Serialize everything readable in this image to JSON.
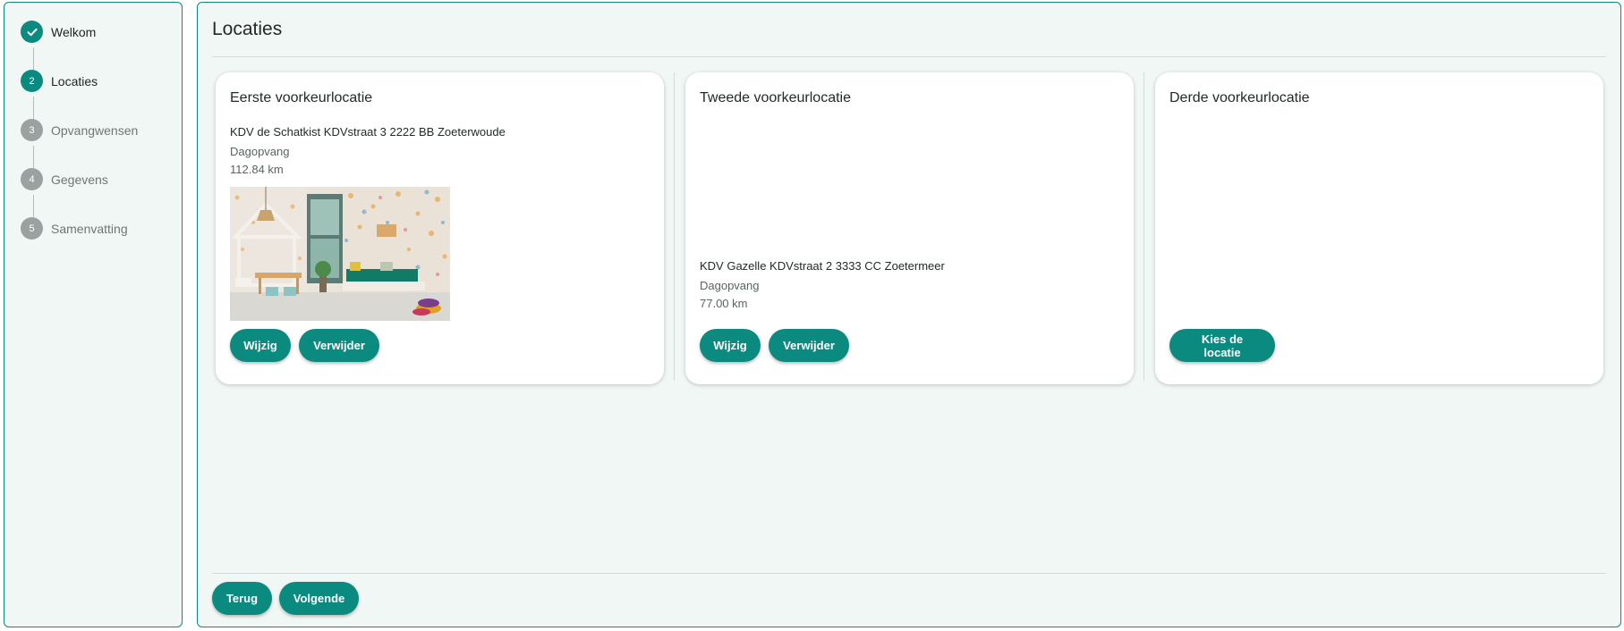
{
  "stepper": {
    "steps": [
      {
        "number": "",
        "label": "Welkom",
        "state": "done",
        "icon": "check-icon"
      },
      {
        "number": "2",
        "label": "Locaties",
        "state": "active"
      },
      {
        "number": "3",
        "label": "Opvangwensen",
        "state": "pending"
      },
      {
        "number": "4",
        "label": "Gegevens",
        "state": "pending"
      },
      {
        "number": "5",
        "label": "Samenvatting",
        "state": "pending"
      }
    ]
  },
  "main": {
    "title": "Locaties",
    "cards": [
      {
        "title": "Eerste voorkeurlocatie",
        "location_name": "KDV de Schatkist KDVstraat 3 2222 BB Zoeterwoude",
        "type": "Dagopvang",
        "distance": "112.84 km",
        "has_photo": true,
        "buttons": {
          "edit": "Wijzig",
          "remove": "Verwijder"
        }
      },
      {
        "title": "Tweede voorkeurlocatie",
        "location_name": "KDV Gazelle KDVstraat 2 3333 CC Zoetermeer",
        "type": "Dagopvang",
        "distance": "77.00 km",
        "has_photo": false,
        "buttons": {
          "edit": "Wijzig",
          "remove": "Verwijder"
        }
      },
      {
        "title": "Derde voorkeurlocatie",
        "buttons": {
          "choose": "Kies de locatie"
        }
      }
    ],
    "footer": {
      "back": "Terug",
      "next": "Volgende"
    }
  },
  "colors": {
    "accent": "#0b8a80",
    "panel_background": "#f1f7f5",
    "pending_step": "#9aa1a1"
  }
}
